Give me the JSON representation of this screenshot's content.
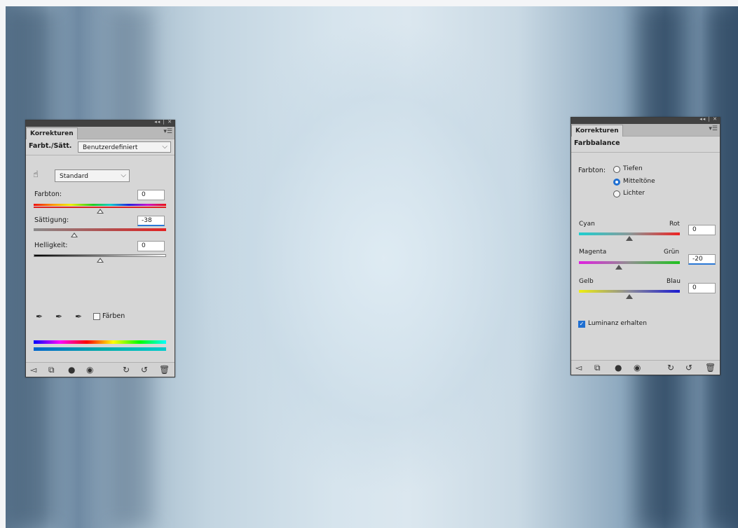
{
  "left_panel": {
    "tab": "Korrekturen",
    "window_controls": "◂◂ | ✕",
    "title": "Farbt./Sätt.",
    "preset": "Benutzerdefiniert",
    "channel": "Standard",
    "hue_label": "Farbton:",
    "hue_value": "0",
    "saturation_label": "Sättigung:",
    "saturation_value": "-38",
    "lightness_label": "Helligkeit:",
    "lightness_value": "0",
    "colorize_label": "Färben"
  },
  "right_panel": {
    "tab": "Korrekturen",
    "window_controls": "◂◂ | ✕",
    "title": "Farbbalance",
    "tone_label": "Farbton:",
    "tone_options": [
      "Tiefen",
      "Mitteltöne",
      "Lichter"
    ],
    "selected_tone": "Mitteltöne",
    "sliders": [
      {
        "left": "Cyan",
        "right": "Rot",
        "value": "0"
      },
      {
        "left": "Magenta",
        "right": "Grün",
        "value": "-20"
      },
      {
        "left": "Gelb",
        "right": "Blau",
        "value": "0"
      }
    ],
    "preserve_luminosity_label": "Luminanz erhalten",
    "preserve_luminosity_checked": true
  }
}
